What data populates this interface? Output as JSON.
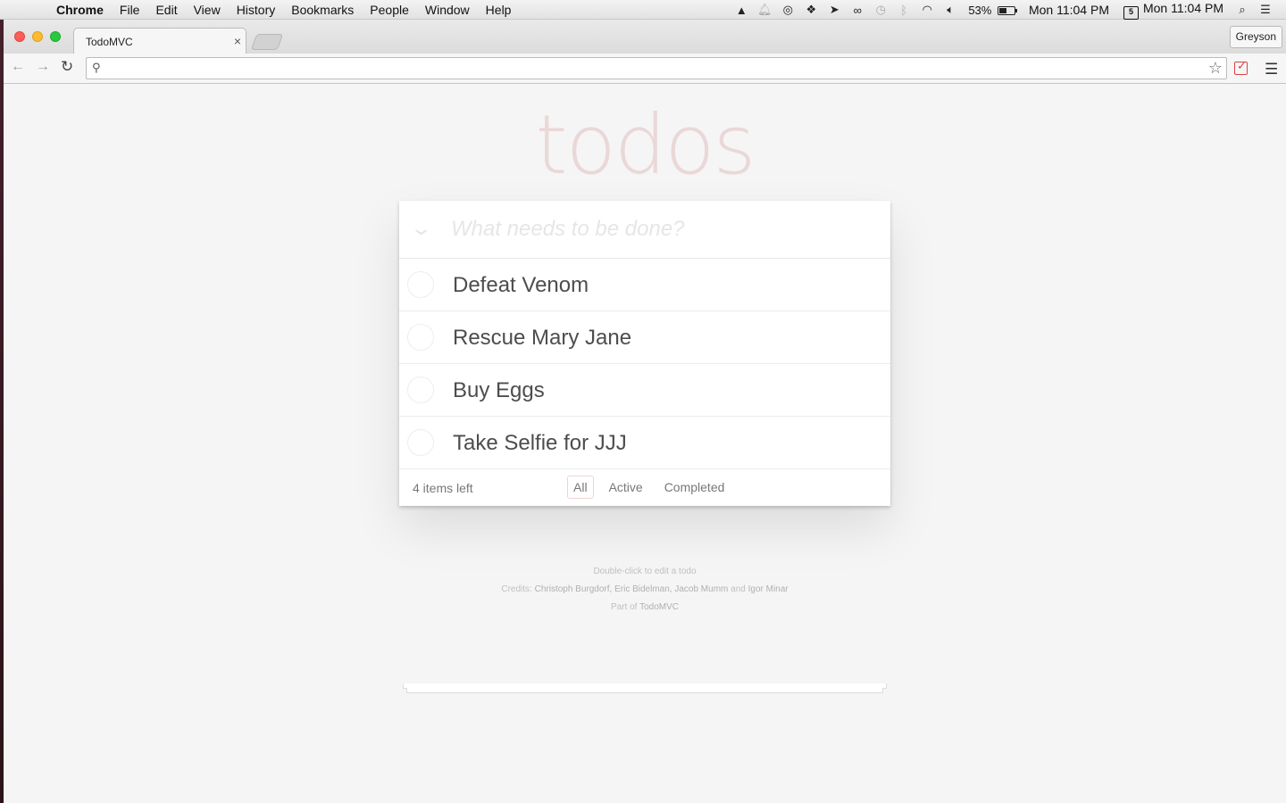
{
  "menubar": {
    "app_name": "Chrome",
    "menus": [
      "File",
      "Edit",
      "View",
      "History",
      "Bookmarks",
      "People",
      "Window",
      "Help"
    ],
    "battery_percent": "53%",
    "battery_level": 0.53,
    "clock_left": "Mon 11:04 PM",
    "calendar_day": "5",
    "clock_right": "Mon 11:04 PM",
    "status_icons": [
      "google-drive-icon",
      "notification-bell-icon",
      "creative-cloud-icon",
      "dropbox-icon",
      "airmail-icon",
      "glasses-icon",
      "time-machine-icon",
      "bluetooth-icon",
      "wifi-icon",
      "volume-icon",
      "search-icon",
      "notification-center-icon"
    ]
  },
  "browser": {
    "tab_title": "TodoMVC",
    "profile_name": "Greyson",
    "address_value": ""
  },
  "todo": {
    "title": "todos",
    "new_todo_placeholder": "What needs to be done?",
    "items": [
      {
        "label": "Defeat Venom",
        "completed": false
      },
      {
        "label": "Rescue Mary Jane",
        "completed": false
      },
      {
        "label": "Buy Eggs",
        "completed": false
      },
      {
        "label": "Take Selfie for JJJ",
        "completed": false
      }
    ],
    "count_text": "4 items left",
    "filters": [
      "All",
      "Active",
      "Completed"
    ],
    "selected_filter": "All"
  },
  "info": {
    "line1": "Double-click to edit a todo",
    "credits_prefix": "Credits:",
    "credits_names": "Christoph Burgdorf, Eric Bidelman, Jacob Mumm",
    "credits_and": "and",
    "credits_last": "Igor Minar",
    "part_of_prefix": "Part of",
    "part_of_link": "TodoMVC"
  },
  "colors": {
    "title_color": "rgba(175,47,47,0.15)",
    "page_background": "#f5f5f5",
    "text": "#4d4d4d"
  }
}
